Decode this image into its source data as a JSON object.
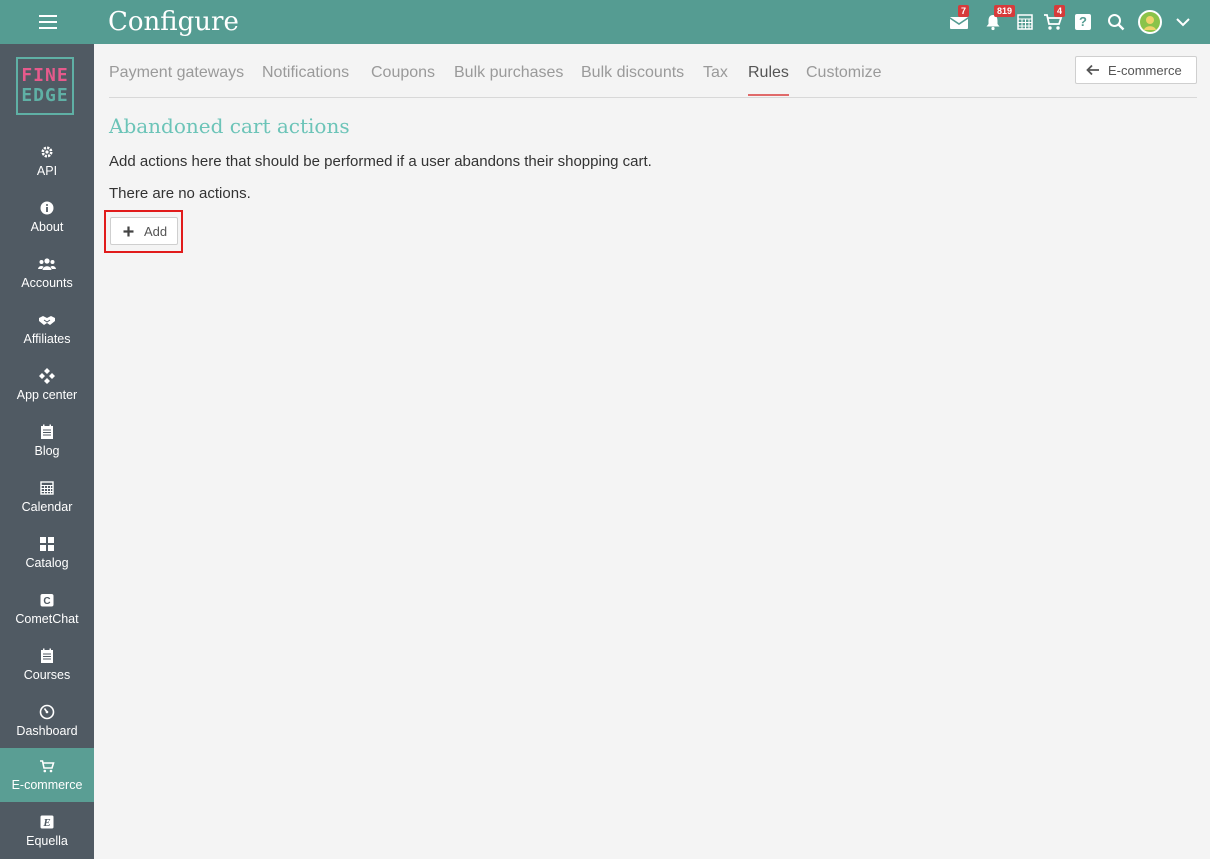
{
  "header": {
    "title": "Configure",
    "icons": {
      "messages": {
        "name": "envelope-icon",
        "badge": "7"
      },
      "notifications": {
        "name": "bell-icon",
        "badge": "819"
      },
      "calendar": {
        "name": "calendar-grid-icon"
      },
      "cart": {
        "name": "cart-icon",
        "badge": "4"
      },
      "help": {
        "name": "help-icon",
        "glyph": "?"
      },
      "search": {
        "name": "search-icon"
      },
      "avatar": {
        "name": "avatar"
      },
      "menu": {
        "name": "chevron-down-icon"
      }
    },
    "colors": {
      "bar": "#559c92",
      "badge": "#d63b3b"
    }
  },
  "sidebar": {
    "logo": {
      "line1": "FINE",
      "line2": "EDGE"
    },
    "items": [
      {
        "label": "API",
        "icon": "gear-icon"
      },
      {
        "label": "About",
        "icon": "info-icon"
      },
      {
        "label": "Accounts",
        "icon": "users-icon"
      },
      {
        "label": "Affiliates",
        "icon": "handshake-icon"
      },
      {
        "label": "App center",
        "icon": "app-center-icon"
      },
      {
        "label": "Blog",
        "icon": "blog-icon"
      },
      {
        "label": "Calendar",
        "icon": "calendar-icon"
      },
      {
        "label": "Catalog",
        "icon": "catalog-icon"
      },
      {
        "label": "CometChat",
        "icon": "cometchat-icon"
      },
      {
        "label": "Courses",
        "icon": "courses-icon"
      },
      {
        "label": "Dashboard",
        "icon": "dashboard-icon"
      },
      {
        "label": "E-commerce",
        "icon": "cart-icon",
        "active": true
      },
      {
        "label": "Equella",
        "icon": "equella-icon"
      }
    ],
    "colors": {
      "background": "#505a63",
      "active": "#5a9e94"
    }
  },
  "tabs": [
    {
      "label": "Payment gateways"
    },
    {
      "label": "Notifications"
    },
    {
      "label": "Coupons"
    },
    {
      "label": "Bulk purchases"
    },
    {
      "label": "Bulk discounts"
    },
    {
      "label": "Tax"
    },
    {
      "label": "Rules",
      "active": true
    },
    {
      "label": "Customize"
    }
  ],
  "back_button": {
    "label": "E-commerce",
    "icon": "arrow-left-icon"
  },
  "content": {
    "heading": "Abandoned cart actions",
    "description": "Add actions here that should be performed if a user abandons their shopping cart.",
    "empty_text": "There are no actions.",
    "add_button": {
      "label": "Add",
      "icon": "plus-icon"
    },
    "colors": {
      "heading": "#6cc4b8",
      "highlight": "#e11b1b",
      "active_tab": "#e06a6a"
    }
  }
}
